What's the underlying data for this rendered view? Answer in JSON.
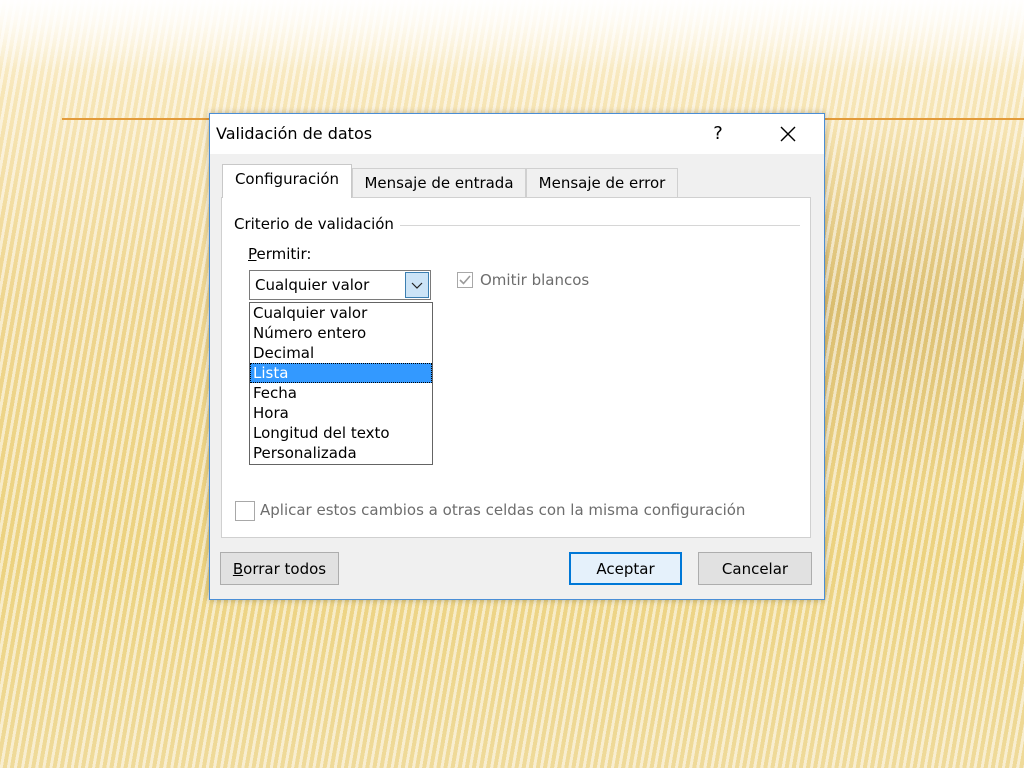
{
  "dialog": {
    "title": "Validación de datos",
    "help_label": "?",
    "tabs": [
      {
        "label": "Configuración"
      },
      {
        "label": "Mensaje de entrada"
      },
      {
        "label": "Mensaje de error"
      }
    ],
    "group_title": "Criterio de validación",
    "permitir": {
      "label_first": "P",
      "label_rest": "ermitir:",
      "current_value": "Cualquier valor",
      "options": [
        {
          "label": "Cualquier valor"
        },
        {
          "label": "Número entero"
        },
        {
          "label": "Decimal"
        },
        {
          "label": "Lista"
        },
        {
          "label": "Fecha"
        },
        {
          "label": "Hora"
        },
        {
          "label": "Longitud del texto"
        },
        {
          "label": "Personalizada"
        }
      ],
      "highlighted_option": "Lista"
    },
    "omitir_blancos": {
      "label": "Omitir blancos",
      "checked": true
    },
    "aplicar_cambios": {
      "label": "Aplicar estos cambios a otras celdas con la misma configuración",
      "checked": false
    },
    "buttons": {
      "borrar_first": "B",
      "borrar_rest": "orrar todos",
      "aceptar": "Aceptar",
      "cancelar": "Cancelar"
    }
  },
  "colors": {
    "accent": "#0078d7",
    "selection": "#3399ff",
    "slide_line": "#e39b3a"
  }
}
